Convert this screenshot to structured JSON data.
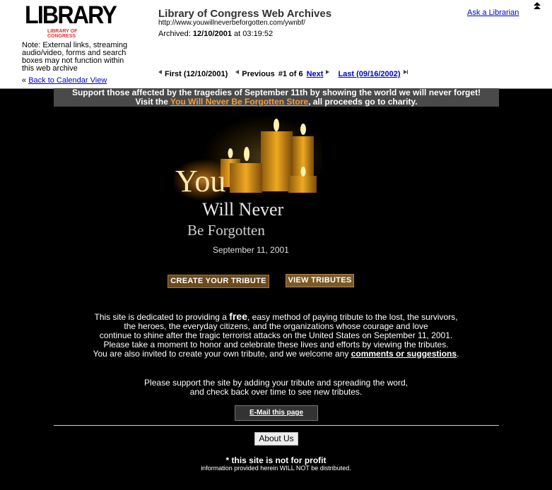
{
  "archive": {
    "logo": "LIBRARY",
    "logo_sub": "LIBRARY OF CONGRESS",
    "note": "Note: External links, streaming audio/video, forms and search boxes may not function within this web archive",
    "back_link": "Back to Calendar View",
    "back_prefix": "«",
    "title": "Library of Congress Web Archives",
    "url": "http://www.youwillneverbeforgotten.com/ywnbf/",
    "archived_label": "Archived:",
    "archived_date": "12/10/2001",
    "archived_at": "at 03:19:52",
    "ask": "Ask a Librarian",
    "nav": {
      "first": "First (12/10/2001)",
      "previous": "Previous",
      "position": "#1 of 6",
      "next": "Next",
      "last": "Last (09/16/2002)"
    }
  },
  "support_banner": {
    "line1": "Support those affected by the tragedies of September 11th by showing the world we will never forget!",
    "line2_pre": "Visit the",
    "store_link": "You Will Never Be Forgotten Store",
    "line2_post": ", all proceeds go to charity."
  },
  "hero": {
    "you": "You",
    "will_never": "Will Never",
    "be_forgotten": "Be Forgotten",
    "date": "September 11, 2001"
  },
  "buttons": {
    "create": "CREATE YOUR TRIBUTE",
    "view": "VIEW TRIBUTES",
    "email": "E-Mail this page",
    "about": "About Us"
  },
  "dedication": {
    "pre": "This site is dedicated to providing a",
    "free": "free",
    "line1_post": ", easy method of paying tribute to the lost, the survivors,",
    "line2": "the heroes, the everyday citizens, and the organizations whose courage and love",
    "line3": "continue to shine after the tragic terrorist attacks on the United States on September 11, 2001.",
    "line4": "Please take a moment to honor and celebrate these lives and efforts by viewing the tributes.",
    "line5_pre": "You are also invited to create your own tribute, and we welcome any",
    "link": "comments or suggestions",
    "line5_post": "."
  },
  "support_text": {
    "line1": "Please support the site by adding your tribute and spreading the word,",
    "line2": "and check back over time to see new tributes."
  },
  "footer": {
    "not_profit": "* this site is not for profit",
    "distributed": "information provided herein WILL NOT be distributed."
  }
}
